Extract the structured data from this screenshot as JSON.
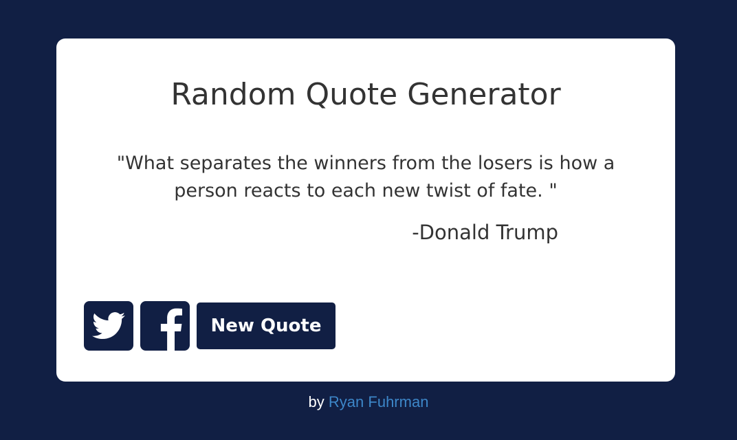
{
  "title": "Random Quote Generator",
  "quote": {
    "text": "\"What separates the winners from the losers is how a person reacts to each new twist of fate. \"",
    "author": "-Donald Trump"
  },
  "buttons": {
    "twitter_icon": "twitter-icon",
    "facebook_icon": "facebook-icon",
    "new_quote_label": "New Quote"
  },
  "footer": {
    "by_label": "by",
    "author_link": "Ryan Fuhrman"
  },
  "colors": {
    "background": "#111f44",
    "card": "#ffffff",
    "link": "#3d87c9",
    "text": "#333333"
  }
}
